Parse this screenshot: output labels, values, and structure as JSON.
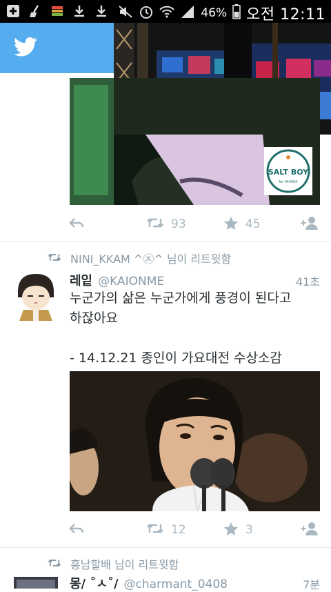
{
  "status_bar": {
    "battery_percent": "46%",
    "time": "오전 12:11",
    "left_icons": [
      "plus-box-icon",
      "broom-icon",
      "equalizer-icon",
      "download-icon",
      "download-icon"
    ],
    "right_icons": [
      "mute-icon",
      "alarm-icon",
      "wifi-icon",
      "signal-icon",
      "battery-icon"
    ]
  },
  "app_bar": {
    "logo": "twitter-bird-icon",
    "brand_color": "#55acee"
  },
  "media_overlay": {
    "watermark": "SALT BOY",
    "watermark_sub": "for Mr.MAX"
  },
  "tweets": [
    {
      "actions": {
        "retweets": "93",
        "favorites": "45"
      }
    },
    {
      "retweeted_by": "NINI_KKAM ^㉨^ 님이 리트윗함",
      "name": "레잍",
      "handle": "@KAIONME",
      "time": "41초",
      "text_line1": "누군가의 삶은 누군가에게 풍경이 된다고",
      "text_line2": "하잖아요",
      "text_line3": "- 14.12.21 종인이 가요대전 수상소감",
      "actions": {
        "retweets": "12",
        "favorites": "3"
      }
    },
    {
      "retweeted_by": "흥남할배 님이 리트윗함",
      "name": "몽/ ˚ㅅ˚/",
      "handle": "@charmant_0408",
      "time": "7분"
    }
  ],
  "colors": {
    "icon_gray": "#aab8c2",
    "text_gray": "#8899a6",
    "text_dark": "#292f33"
  }
}
